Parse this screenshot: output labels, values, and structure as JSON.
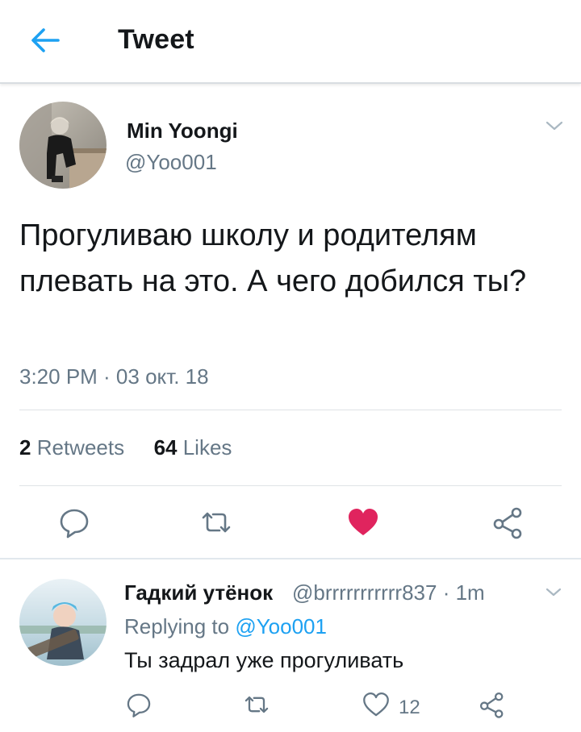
{
  "header": {
    "title": "Tweet",
    "back_icon": "arrow-left-icon",
    "accent_color": "#1da1f2"
  },
  "tweet": {
    "author_name": "Min Yoongi",
    "author_handle": "@Yoo001",
    "text": "Прогуливаю школу и родителям плевать на это. А чего добился ты?",
    "timestamp": "3:20 PM · 03 окт. 18",
    "retweets_count": "2",
    "retweets_label": "Retweets",
    "likes_count": "64",
    "likes_label": "Likes",
    "liked": true,
    "like_color": "#e0245e",
    "actions": [
      "reply-icon",
      "retweet-icon",
      "heart-filled-icon",
      "share-icon"
    ]
  },
  "reply": {
    "author_name": "Гадкий утёнок",
    "meta": "@brrrrrrrrrrr837 · 1m",
    "replying_prefix": "Replying to",
    "replying_handle": "@Yoo001",
    "text": "Ты задрал уже прогуливать",
    "like_count": "12",
    "actions": [
      "reply-icon",
      "retweet-icon",
      "heart-outline-icon",
      "share-icon"
    ]
  },
  "colors": {
    "text_primary": "#14171a",
    "text_secondary": "#657786",
    "divider": "#e1e8ed"
  }
}
